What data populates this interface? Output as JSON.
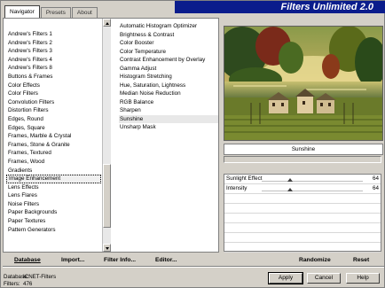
{
  "tabs": [
    {
      "label": "Navigator",
      "active": true
    },
    {
      "label": "Presets",
      "active": false
    },
    {
      "label": "About",
      "active": false
    }
  ],
  "title": "Filters Unlimited 2.0",
  "categories": [
    "Andrew's Filters 1",
    "Andrew's Filters 2",
    "Andrew's Filters 3",
    "Andrew's Filters 4",
    "Andrew's Filters 8",
    "Buttons & Frames",
    "Color Effects",
    "Color Filters",
    "Convolution Filters",
    "Distortion Filters",
    "Edges, Round",
    "Edges, Square",
    "Frames, Marble & Crystal",
    "Frames, Stone & Granite",
    "Frames, Textured",
    "Frames, Wood",
    "Gradients",
    "Image Enhancement",
    "Lens Effects",
    "Lens Flares",
    "Noise Filters",
    "Paper Backgrounds",
    "Paper Textures",
    "Pattern Generators"
  ],
  "selected_category": "Image Enhancement",
  "filters": [
    "Automatic Histogram Optimizer",
    "Brightness & Contrast",
    "Color Booster",
    "Color Temperature",
    "Contrast Enhancement by Overlay",
    "Gamma Adjust",
    "Histogram Stretching",
    "Hue, Saturation, Lightness",
    "Median Noise Reduction",
    "RGB Balance",
    "Sharpen",
    "Sunshine",
    "Unsharp Mask"
  ],
  "selected_filter": "Sunshine",
  "filter_name_display": "Sunshine",
  "params": [
    {
      "name": "Sunlight Effect",
      "value": "64",
      "level": 0.25
    },
    {
      "name": "Intensity",
      "value": "64",
      "level": 0.25
    }
  ],
  "bottom_left_buttons": {
    "database": "Database",
    "import": "Import...",
    "filter_info": "Filter Info...",
    "editor": "Editor..."
  },
  "bottom_right_buttons": {
    "randomize": "Randomize",
    "reset": "Reset"
  },
  "status": {
    "database_label": "Database:",
    "database_value": "ICNET-Filters",
    "filters_label": "Filters:",
    "filters_value": "476"
  },
  "dialog_buttons": {
    "apply": "Apply",
    "cancel": "Cancel",
    "help": "Help"
  },
  "colors": {
    "banner": "#0a1c8c",
    "selection": "#0a246a"
  }
}
